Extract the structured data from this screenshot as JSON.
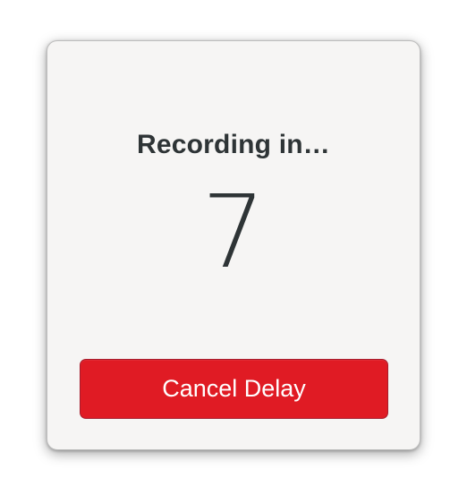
{
  "dialog": {
    "title": "Recording in…",
    "countdown": "7",
    "cancel_label": "Cancel Delay"
  },
  "colors": {
    "accent_destructive": "#e01b24",
    "text": "#2e3436",
    "background": "#f6f5f4"
  }
}
